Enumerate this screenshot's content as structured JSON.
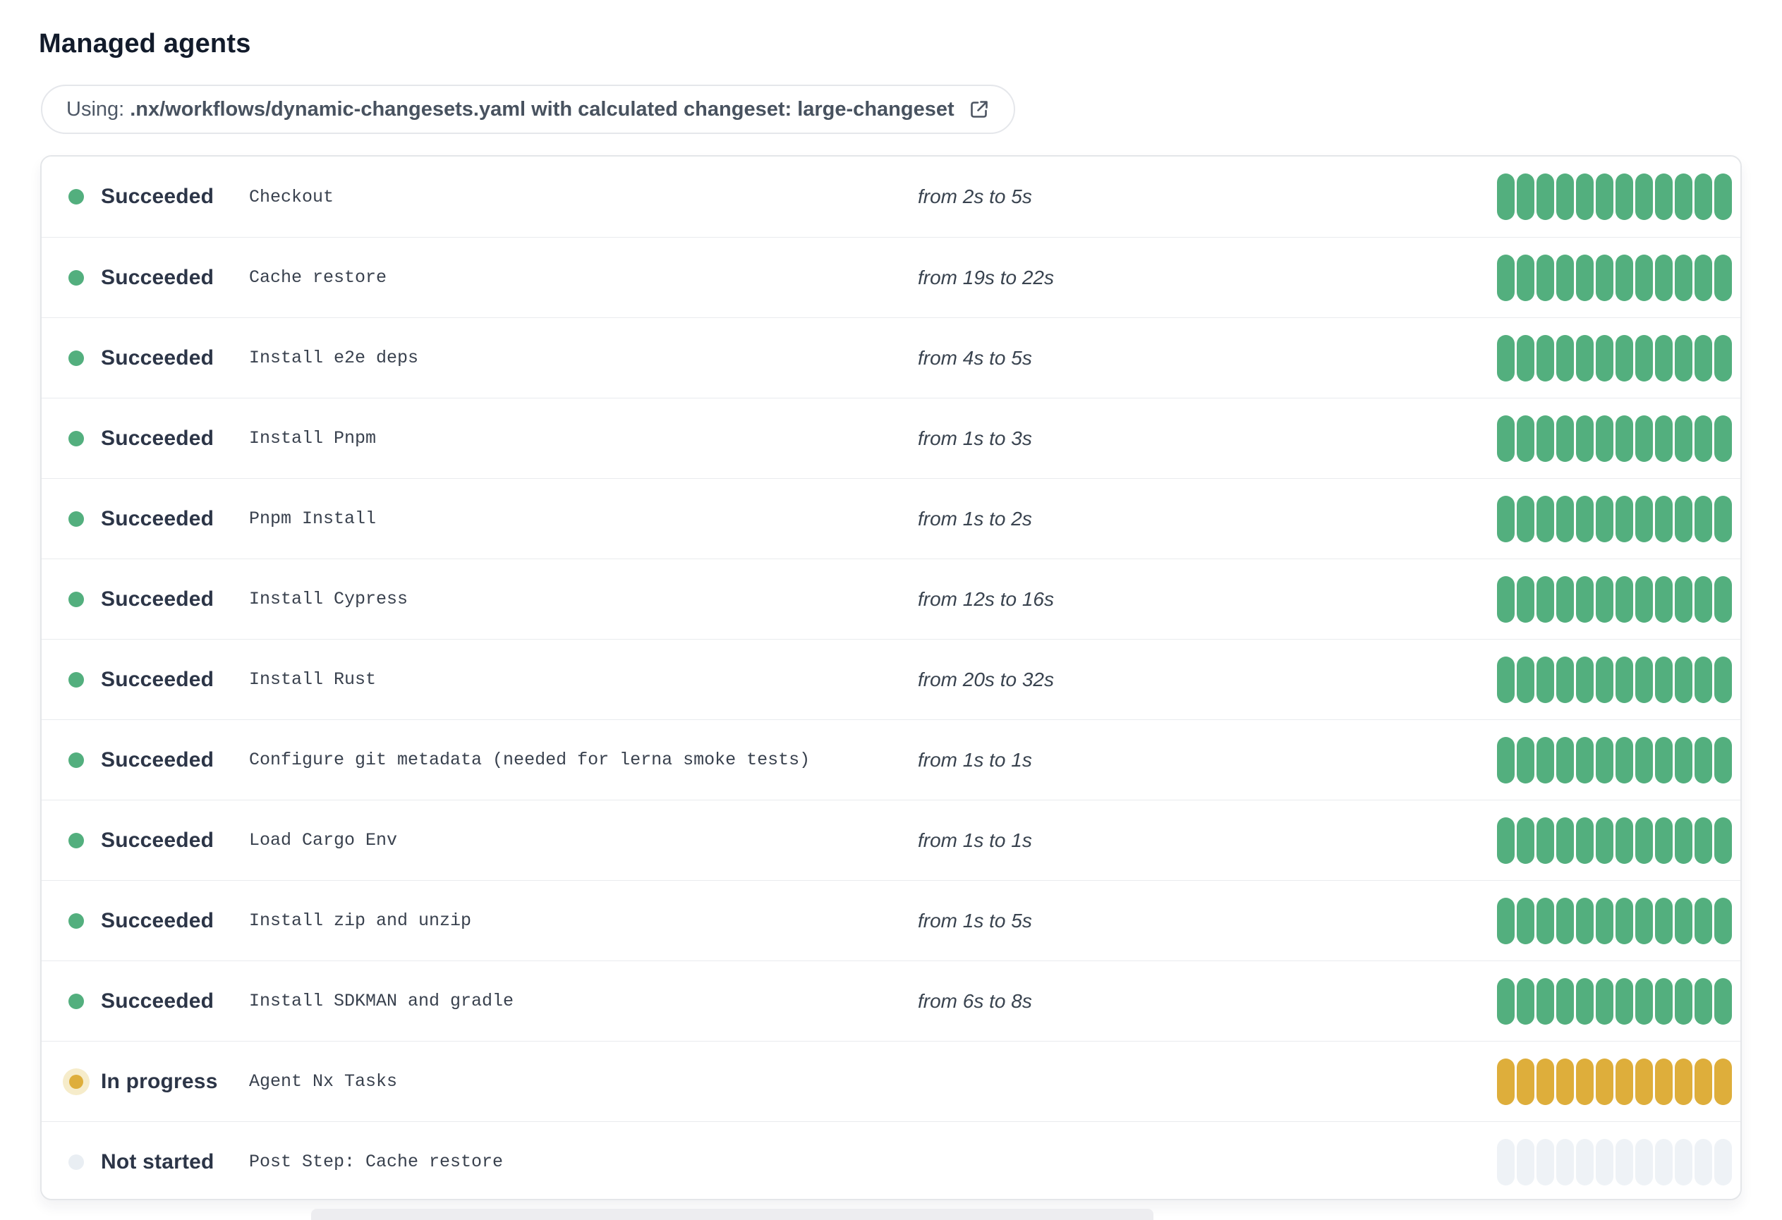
{
  "header": {
    "title": "Managed agents"
  },
  "banner": {
    "prefix": "Using:",
    "detail": ".nx/workflows/dynamic-changesets.yaml with calculated changeset: large-changeset",
    "icon": "external-link-icon"
  },
  "colors": {
    "succeeded": "#53af7e",
    "in_progress": "#deae3b",
    "in_progress_halo": "#f6ecca",
    "not_started_segment": "#eef2f6",
    "not_started_dot": "#e9eef3"
  },
  "agents": {
    "segments_per_bar": 12,
    "rows": [
      {
        "state": "succeeded",
        "status_label": "Succeeded",
        "step": "Checkout",
        "time_range": "from 2s to 5s"
      },
      {
        "state": "succeeded",
        "status_label": "Succeeded",
        "step": "Cache restore",
        "time_range": "from 19s to 22s"
      },
      {
        "state": "succeeded",
        "status_label": "Succeeded",
        "step": "Install e2e deps",
        "time_range": "from 4s to 5s"
      },
      {
        "state": "succeeded",
        "status_label": "Succeeded",
        "step": "Install Pnpm",
        "time_range": "from 1s to 3s"
      },
      {
        "state": "succeeded",
        "status_label": "Succeeded",
        "step": "Pnpm Install",
        "time_range": "from 1s to 2s"
      },
      {
        "state": "succeeded",
        "status_label": "Succeeded",
        "step": "Install Cypress",
        "time_range": "from 12s to 16s"
      },
      {
        "state": "succeeded",
        "status_label": "Succeeded",
        "step": "Install Rust",
        "time_range": "from 20s to 32s"
      },
      {
        "state": "succeeded",
        "status_label": "Succeeded",
        "step": "Configure git metadata (needed for lerna smoke tests)",
        "time_range": "from 1s to 1s"
      },
      {
        "state": "succeeded",
        "status_label": "Succeeded",
        "step": "Load Cargo Env",
        "time_range": "from 1s to 1s"
      },
      {
        "state": "succeeded",
        "status_label": "Succeeded",
        "step": "Install zip and unzip",
        "time_range": "from 1s to 5s"
      },
      {
        "state": "succeeded",
        "status_label": "Succeeded",
        "step": "Install SDKMAN and gradle",
        "time_range": "from 6s to 8s"
      },
      {
        "state": "in_progress",
        "status_label": "In progress",
        "step": "Agent Nx Tasks",
        "time_range": ""
      },
      {
        "state": "not_started",
        "status_label": "Not started",
        "step": "Post Step: Cache restore",
        "time_range": ""
      }
    ]
  }
}
